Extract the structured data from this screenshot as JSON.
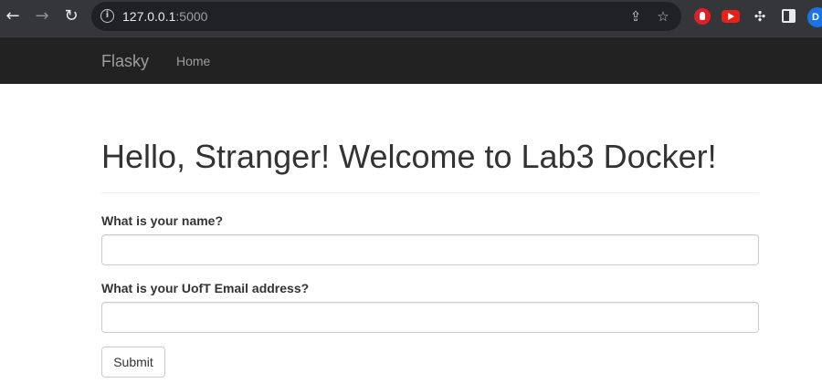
{
  "browser": {
    "url_host": "127.0.0.1",
    "url_port": ":5000",
    "avatar_letter": "D",
    "icons": [
      "back-arrow-icon",
      "forward-arrow-icon",
      "reload-icon",
      "info-icon",
      "share-icon",
      "star-icon",
      "adblock-extension-icon",
      "youtube-extension-icon",
      "puzzle-icon",
      "side-panel-icon"
    ]
  },
  "navbar": {
    "brand": "Flasky",
    "links": [
      {
        "label": "Home"
      }
    ]
  },
  "main": {
    "heading": "Hello, Stranger! Welcome to Lab3 Docker!",
    "form": {
      "name_label": "What is your name?",
      "name_value": "",
      "email_label": "What is your UofT Email address?",
      "email_value": "",
      "submit_label": "Submit"
    }
  },
  "colors": {
    "navbar_bg": "#222222",
    "chrome_bg": "#35363a",
    "heading_text": "#333333"
  }
}
